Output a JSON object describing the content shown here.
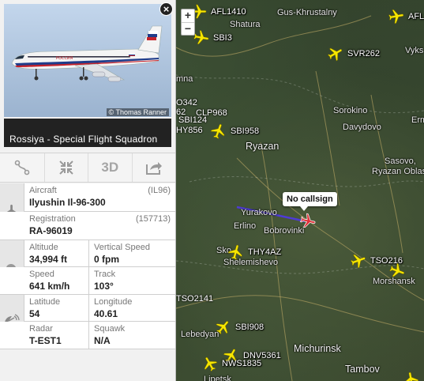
{
  "map": {
    "zoom_in": "+",
    "zoom_out": "−",
    "cities": [
      {
        "name": "Gus-Khrustalny"
      },
      {
        "name": "Shatura"
      },
      {
        "name": "Vyks"
      },
      {
        "name": "mna"
      },
      {
        "name": "Ryazan"
      },
      {
        "name": "Sorokino"
      },
      {
        "name": "Davydovo"
      },
      {
        "name": "Erm"
      },
      {
        "name": "Sasovo,"
      },
      {
        "name": "Ryazan Oblas"
      },
      {
        "name": "Yurakovo"
      },
      {
        "name": "Erlino"
      },
      {
        "name": "Bobrovinki"
      },
      {
        "name": "Sko"
      },
      {
        "name": "Shelemishevo"
      },
      {
        "name": "Morshansk"
      },
      {
        "name": "Lebedyan"
      },
      {
        "name": "Michurinsk"
      },
      {
        "name": "Tambov"
      },
      {
        "name": "Lipetsk"
      }
    ],
    "flights": [
      {
        "callsign": "AFL1410"
      },
      {
        "callsign": "AFL"
      },
      {
        "callsign": "SBI3"
      },
      {
        "callsign": "SVR262"
      },
      {
        "callsign": "O342"
      },
      {
        "callsign": "62"
      },
      {
        "callsign": "CLP968"
      },
      {
        "callsign": "SBI124"
      },
      {
        "callsign": "HY856"
      },
      {
        "callsign": "SBI958"
      },
      {
        "callsign": "THY4AZ"
      },
      {
        "callsign": "TSO216"
      },
      {
        "callsign": "TSO2141"
      },
      {
        "callsign": "SBI908"
      },
      {
        "callsign": "DNV5361"
      },
      {
        "callsign": "NWS1835"
      },
      {
        "callsign": "TSO"
      }
    ],
    "selected_tooltip": "No callsign",
    "colors": {
      "plane": "#f7e600",
      "selected_plane": "#e0313a",
      "trail": "#4e3bd4"
    }
  },
  "panel": {
    "close": "×",
    "photo_credit": "© Thomas Ranner",
    "operator": "Rossiya - Special Flight Squadron",
    "toolbar": {
      "route_icon": "route-icon",
      "expand_icon": "expand-icon",
      "view3d": "3D",
      "share_icon": "share-icon"
    },
    "aircraft": {
      "label": "Aircraft",
      "code": "(IL96)",
      "value": "Ilyushin Il-96-300"
    },
    "registration": {
      "label": "Registration",
      "code": "(157713)",
      "value": "RA-96019"
    },
    "altitude": {
      "label": "Altitude",
      "value": "34,994 ft"
    },
    "vertical_speed": {
      "label": "Vertical Speed",
      "value": "0 fpm"
    },
    "speed": {
      "label": "Speed",
      "value": "641 km/h"
    },
    "track": {
      "label": "Track",
      "value": "103°"
    },
    "latitude": {
      "label": "Latitude",
      "value": "54"
    },
    "longitude": {
      "label": "Longitude",
      "value": "40.61"
    },
    "radar": {
      "label": "Radar",
      "value": "T-EST1"
    },
    "squawk": {
      "label": "Squawk",
      "value": "N/A"
    }
  }
}
